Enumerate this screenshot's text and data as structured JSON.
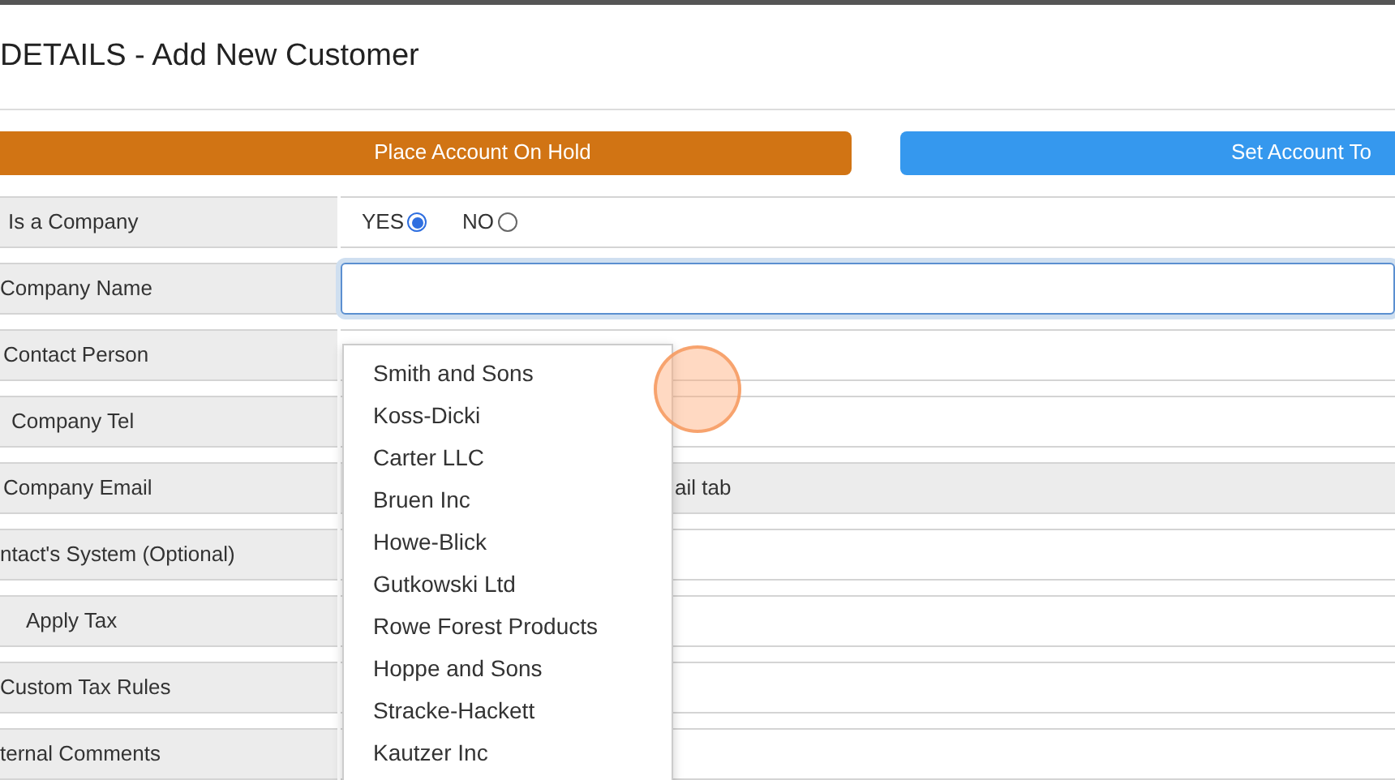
{
  "title": "DETAILS - Add New Customer",
  "actions": [
    {
      "label": "Place Account On Hold",
      "kind": "hold"
    },
    {
      "label": "Set Account To",
      "kind": "set"
    }
  ],
  "rows": [
    {
      "label": "Is a Company",
      "kind": "radio",
      "options": [
        {
          "label": "YES",
          "selected": true
        },
        {
          "label": "NO",
          "selected": false
        }
      ]
    },
    {
      "label": "Company Name",
      "kind": "input",
      "value": "",
      "focused": true
    },
    {
      "label": "Contact Person",
      "kind": "input"
    },
    {
      "label": "Company Tel",
      "kind": "input"
    },
    {
      "label": "Company Email",
      "kind": "note",
      "note": "ail tab"
    },
    {
      "label": "ntact's System (Optional)",
      "kind": "input"
    },
    {
      "label": "Apply Tax",
      "kind": "input"
    },
    {
      "label": "Custom Tax Rules",
      "kind": "input"
    },
    {
      "label": "ternal Comments",
      "kind": "input"
    }
  ],
  "suggestions": [
    "Smith and Sons",
    "Koss-Dicki",
    "Carter LLC",
    "Bruen Inc",
    "Howe-Blick",
    "Gutkowski Ltd",
    "Rowe Forest Products",
    "Hoppe and Sons",
    "Stracke-Hackett",
    "Kautzer Inc"
  ]
}
